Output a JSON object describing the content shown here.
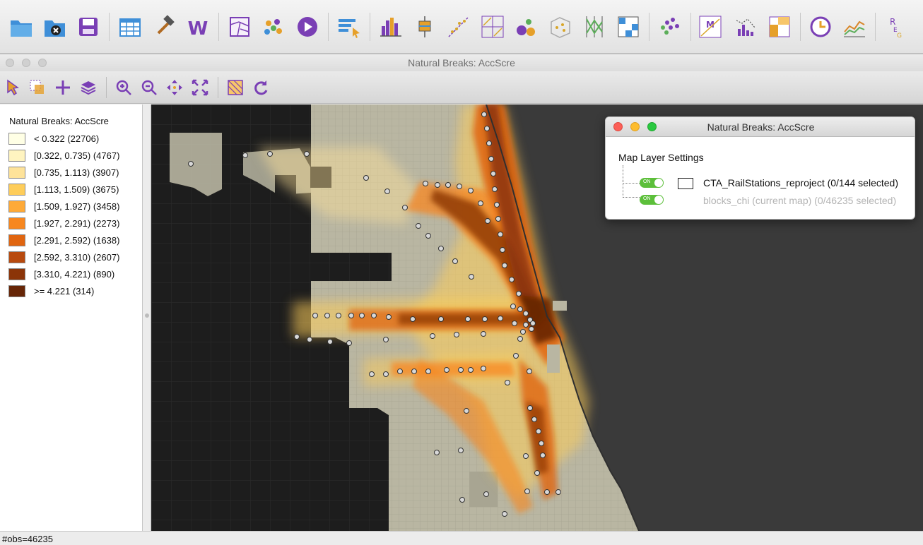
{
  "main_toolbar": {
    "icons": [
      {
        "name": "open-project-icon",
        "color": "#3f8fd8"
      },
      {
        "name": "close-project-icon",
        "color": "#3f8fd8"
      },
      {
        "name": "save-icon",
        "color": "#7a3fb5"
      },
      {
        "name": "table-icon",
        "color": "#3f8fd8"
      },
      {
        "name": "tools-hammer-icon",
        "color": "#d8872a"
      },
      {
        "name": "weights-manager-icon",
        "color": "#7a3fb5"
      },
      {
        "name": "map-icon",
        "color": "#7a3fb5"
      },
      {
        "name": "cluster-map-icon",
        "color": "#e6a02a"
      },
      {
        "name": "play-animation-icon",
        "color": "#7a3fb5"
      },
      {
        "name": "select-by-icon",
        "color": "#3f8fd8"
      },
      {
        "name": "histogram-icon",
        "color": "#7a3fb5"
      },
      {
        "name": "box-plot-icon",
        "color": "#e6a02a"
      },
      {
        "name": "scatter-plot-icon",
        "color": "#d8a62a"
      },
      {
        "name": "scatter-matrix-icon",
        "color": "#7a3fb5"
      },
      {
        "name": "bubble-chart-icon",
        "color": "#e6a02a"
      },
      {
        "name": "3d-plot-icon",
        "color": "#d8a62a"
      },
      {
        "name": "parallel-coordinates-icon",
        "color": "#5cae5a"
      },
      {
        "name": "conditional-plot-icon",
        "color": "#3f8fd8"
      },
      {
        "name": "cluster-icon",
        "color": "#7a3fb5"
      },
      {
        "name": "moran-scatter-icon",
        "color": "#7a3fb5"
      },
      {
        "name": "correlogram-icon",
        "color": "#7a3fb5"
      },
      {
        "name": "spatial-map-icon",
        "color": "#e6a02a"
      },
      {
        "name": "time-editor-icon",
        "color": "#7a3fb5"
      },
      {
        "name": "averages-chart-icon",
        "color": "#d8872a"
      },
      {
        "name": "regression-icon",
        "color": "#7a3fb5"
      }
    ]
  },
  "map_window": {
    "title": "Natural Breaks: AccScre",
    "toolbar_icons": [
      {
        "name": "select-pointer-icon"
      },
      {
        "name": "selection-mode-icon"
      },
      {
        "name": "add-layer-icon"
      },
      {
        "name": "layers-icon"
      },
      {
        "name": "zoom-in-icon"
      },
      {
        "name": "zoom-out-icon"
      },
      {
        "name": "pan-icon"
      },
      {
        "name": "full-extent-icon"
      },
      {
        "name": "basemap-icon"
      },
      {
        "name": "refresh-icon"
      }
    ]
  },
  "legend": {
    "title": "Natural Breaks: AccScre",
    "items": [
      {
        "label": "< 0.322 (22706)",
        "color": "#ffffe5"
      },
      {
        "label": "[0.322, 0.735) (4767)",
        "color": "#fff4c0"
      },
      {
        "label": "[0.735, 1.113) (3907)",
        "color": "#fee39a"
      },
      {
        "label": "[1.113, 1.509) (3675)",
        "color": "#fecd5a"
      },
      {
        "label": "[1.509, 1.927) (3458)",
        "color": "#feaa38"
      },
      {
        "label": "[1.927, 2.291) (2273)",
        "color": "#f7871f"
      },
      {
        "label": "[2.291, 2.592) (1638)",
        "color": "#e06510"
      },
      {
        "label": "[2.592, 3.310) (2607)",
        "color": "#b84a0e"
      },
      {
        "label": "[3.310, 4.221) (890)",
        "color": "#8b3408"
      },
      {
        "label": ">= 4.221 (314)",
        "color": "#662506"
      }
    ]
  },
  "status_bar": {
    "text": "#obs=46235"
  },
  "layer_panel": {
    "title": "Natural Breaks: AccScre",
    "heading": "Map Layer Settings",
    "toggle_label": "ON",
    "layers": [
      {
        "label": "CTA_RailStations_reproject (0/144 selected)",
        "visible": "ON"
      },
      {
        "label": "blocks_chi (current map) (0/46235 selected)",
        "visible": "ON"
      }
    ]
  }
}
